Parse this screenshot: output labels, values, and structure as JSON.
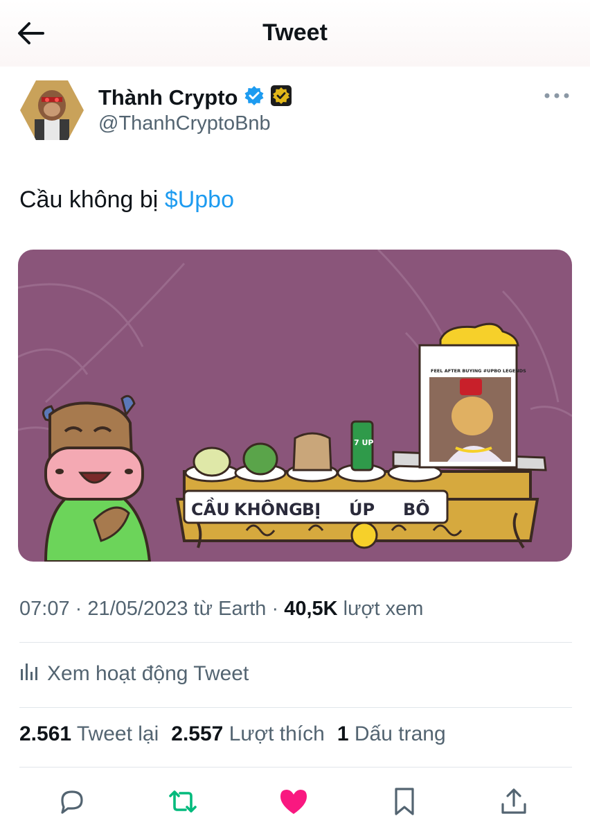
{
  "header": {
    "title": "Tweet"
  },
  "author": {
    "display_name": "Thành Crypto",
    "handle": "@ThanhCryptoBnb",
    "badges": [
      "verified-check-icon",
      "gold-affiliate-badge-icon"
    ]
  },
  "tweet": {
    "text": "Cầu không bị ",
    "cashtag": "$Upbo"
  },
  "media": {
    "meme_caption": "FEEL AFTER BUYING #UPBO LEGENDS",
    "table_words": [
      "CẦU",
      "KHÔNG",
      "BỊ",
      "ÚP",
      "BÔ"
    ],
    "can_label": "7 UP"
  },
  "meta": {
    "time": "07:07",
    "sep1": " · ",
    "date": "21/05/2023",
    "source": " từ Earth",
    "sep2": " · ",
    "views": "40,5K",
    "views_label": " lượt xem"
  },
  "activity": {
    "label": "Xem hoạt động Tweet"
  },
  "stats": {
    "retweets": "2.561",
    "retweets_label": "Tweet lại",
    "likes": "2.557",
    "likes_label": "Lượt thích",
    "bookmarks": "1",
    "bookmarks_label": "Dấu trang"
  },
  "colors": {
    "accent": "#1d9bf0",
    "retweet": "#00ba7c",
    "like": "#f91880",
    "muted": "#536471",
    "media_bg": "#8a557a"
  },
  "actions": [
    "reply-icon",
    "retweet-icon",
    "like-icon",
    "bookmark-icon",
    "share-icon"
  ]
}
